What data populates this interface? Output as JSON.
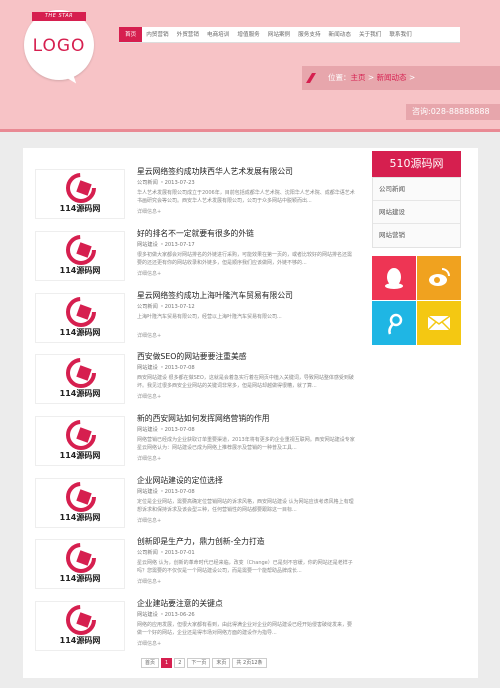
{
  "logo": {
    "ribbon": "THE STAR",
    "text": "LOGO"
  },
  "nav": {
    "items": [
      "首页",
      "内贸营销",
      "外贸营销",
      "电商培训",
      "增值服务",
      "网站案例",
      "服务支持",
      "新闻动态",
      "关于我们",
      "联系我们"
    ],
    "active_index": 0
  },
  "breadcrumb": {
    "prefix": "位置：",
    "home": "主页",
    "sep1": " > ",
    "current": "新闻动态",
    "sep2": " >"
  },
  "phone": "咨询:028-88888888",
  "articles": [
    {
      "title": "星云网络签约成功陕西华人艺术发展有限公司",
      "meta": "公司新闻 ・2013-07-23",
      "summary": "华人艺术发展有限公司成立于2006年，目前包括成都华人艺术院、沈阳华人艺术院、成都华语艺术书画研究会等公司。西安华人艺术发展有限公司，公司于众多网站中脱颖而出...",
      "more": "详细信息+",
      "brand": "114源码网"
    },
    {
      "title": "好的排名不一定就要有很多的外链",
      "meta": "网站建设 ・2013-07-17",
      "summary": "很多初做大家都会对网站排名的外链进行采购，可能效果在第一页的，或者比较好的网站排名还需要的还还更有你的网站收录和外链多，但是顺序我们应该做网，外链不够的...",
      "more": "详细信息+",
      "brand": "114源码网"
    },
    {
      "title": "星云网络签约成功上海叶隆汽车贸易有限公司",
      "meta": "公司新闻 ・2013-07-12",
      "summary": "上海叶隆汽车贸易有限公司，经营以上海叶隆汽车贸易有限公司...",
      "more": "详细信息+",
      "brand": "114源码网"
    },
    {
      "title": "西安做SEO的网站要要注重美感",
      "meta": "网站建设 ・2013-07-08",
      "summary": "西安网站建设 很多都在做SEO，这就是会着急实行着在网页中植入关键词，导致网站整体感受到破坏。我见过很多西安企业网站的关键词非常多，但是网站却越做得很糟，就了算...",
      "more": "详细信息+",
      "brand": "114源码网"
    },
    {
      "title": "新的西安网站如何发挥网络营销的作用",
      "meta": "网站建设 ・2013-07-08",
      "summary": "网络营销已经成为企业获取订单重要渠道，2013年将有更多的企业重视互联网。西安网站建设专家星云网络认为：网站建设已成为网络上推荐展示及营销的一种普及工具...",
      "more": "详细信息+",
      "brand": "114源码网"
    },
    {
      "title": "企业网站建设的定位选择",
      "meta": "网站建设 ・2013-07-08",
      "summary": "定位是企业网站，需要高确定位营销网站的诉求风格，西安网站建设 认为网站应该考虑风格上有理想诉求和保持诉求及该会型三种，任何营销性的网站都要跟踪这一目标...",
      "more": "详细信息+",
      "brand": "114源码网"
    },
    {
      "title": "创新即是生产力，鼎力创新-全力打造",
      "meta": "公司新闻 ・2013-07-01",
      "summary": "星云网络 认为，创新的革命时代已经来临，改变（Change）已是刻不容缓，你的网站还是老样子吗？您需要的不仅仅是一个网站建设公司，而是需要一个能帮助品牌成长...",
      "more": "详细信息+",
      "brand": "114源码网"
    },
    {
      "title": "企业建站要注意的关键点",
      "meta": "网站建设 ・2013-06-26",
      "summary": "网络的应用发展，但很大家都有看到，由此得满企业对企业的网站建设已经开始侵害破绽发来，要做一个好的网站，企业还是得市场对网络方面的建设作为指导...",
      "more": "详细信息+",
      "brand": "114源码网"
    }
  ],
  "pager": {
    "first": "首页",
    "pages": [
      "1",
      "2"
    ],
    "active_page": "1",
    "next": "下一页",
    "last": "末页",
    "total": "共 2页12条"
  },
  "sidebar": {
    "title": "510源码网",
    "items": [
      "公司新闻",
      "网站建设",
      "网站营销"
    ]
  },
  "social": {
    "icons": [
      "qq-icon",
      "weibo-icon",
      "tencent-weibo-icon",
      "email-icon"
    ]
  },
  "colors": {
    "brand": "#d61f4f",
    "header_bg": "#f7c3c6",
    "bar": "#e7a6ac"
  }
}
